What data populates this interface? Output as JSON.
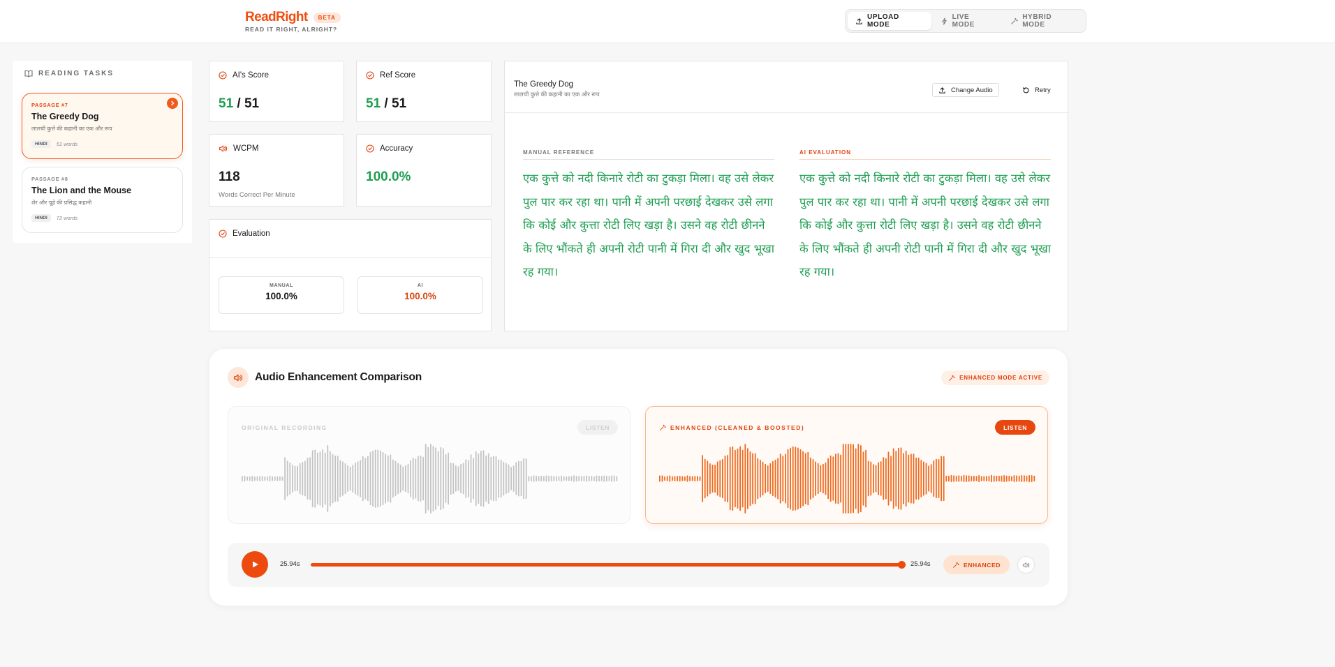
{
  "header": {
    "brand": "ReadRight",
    "beta": "BETA",
    "tagline": "READ IT RIGHT, ALRIGHT?",
    "modes": [
      {
        "label": "UPLOAD MODE",
        "icon": "upload-icon",
        "active": true
      },
      {
        "label": "LIVE MODE",
        "icon": "lightning-icon",
        "active": false
      },
      {
        "label": "HYBRID MODE",
        "icon": "sparkle-icon",
        "active": false
      }
    ]
  },
  "sidebar": {
    "title": "READING TASKS",
    "tasks": [
      {
        "tag": "PASSAGE #7",
        "title": "The Greedy Dog",
        "subtitle": "लालची कुत्ते की कहानी का एक और रूप",
        "language": "HINDI",
        "words": "51 words",
        "active": true
      },
      {
        "tag": "PASSAGE #8",
        "title": "The Lion and the Mouse",
        "subtitle": "शेर और चूहे की प्रसिद्ध कहानी",
        "language": "HINDI",
        "words": "72 words",
        "active": false
      }
    ]
  },
  "stats": {
    "ai_score": {
      "label": "AI's Score",
      "value": "51",
      "total": "/ 51"
    },
    "ref_score": {
      "label": "Ref Score",
      "value": "51",
      "total": "/ 51"
    },
    "wcpm": {
      "label": "WCPM",
      "value": "118",
      "hint": "Words Correct Per Minute"
    },
    "accuracy": {
      "label": "Accuracy",
      "value": "100.0%"
    },
    "evaluation": {
      "label": "Evaluation",
      "manual_label": "MANUAL",
      "manual_value": "100.0%",
      "ai_label": "AI",
      "ai_value": "100.0%"
    }
  },
  "passage": {
    "title": "The Greedy Dog",
    "subtitle": "लालची कुत्ते की कहानी का एक और रूप",
    "change_audio": "Change Audio",
    "retry": "Retry",
    "manual_header": "MANUAL REFERENCE",
    "ai_header": "AI EVALUATION",
    "manual_text": "एक कुत्ते को नदी किनारे रोटी का टुकड़ा मिला। वह उसे लेकर पुल पार कर रहा था। पानी में अपनी परछाई देखकर उसे लगा कि कोई और कुत्ता रोटी लिए खड़ा है। उसने वह रोटी छीनने के लिए भौंकते ही अपनी रोटी पानी में गिरा दी और खुद भूखा रह गया।",
    "ai_text": "एक कुत्ते को नदी किनारे रोटी का टुकड़ा मिला। वह उसे लेकर पुल पार कर रहा था। पानी में अपनी परछाई देखकर उसे लगा कि कोई और कुत्ता रोटी लिए खड़ा है। उसने वह रोटी छीनने के लिए भौंकते ही अपनी रोटी पानी में गिरा दी और खुद भूखा रह गया।"
  },
  "audio": {
    "title": "Audio Enhancement Comparison",
    "mode_badge": "ENHANCED MODE ACTIVE",
    "original_label": "ORIGINAL RECORDING",
    "enhanced_label": "ENHANCED (CLEANED & BOOSTED)",
    "listen": "LISTEN",
    "current_time": "25.94s",
    "duration": "25.94s",
    "progress": 1.0,
    "enhanced_toggle": "ENHANCED"
  },
  "colors": {
    "accent": "#f04e10",
    "correct_green": "#1e9e52",
    "original_wave": "#c4c4c4",
    "enhanced_wave": "#ef6a1e"
  }
}
